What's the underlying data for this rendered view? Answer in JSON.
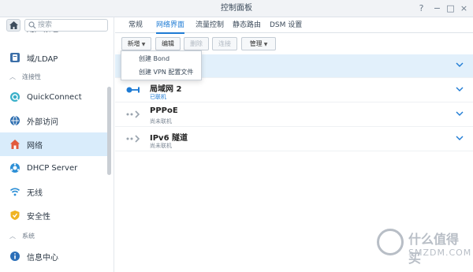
{
  "window": {
    "title": "控制面板"
  },
  "sidebar": {
    "search_placeholder": "搜索",
    "clipped_item": "用户帐组",
    "items": [
      {
        "label": "域/LDAP",
        "icon": "domain-ldap-icon"
      },
      {
        "label": "QuickConnect",
        "icon": "quickconnect-icon"
      },
      {
        "label": "外部访问",
        "icon": "external-access-icon"
      },
      {
        "label": "网络",
        "icon": "network-home-icon",
        "active": true
      },
      {
        "label": "DHCP Server",
        "icon": "dhcp-server-icon"
      },
      {
        "label": "无线",
        "icon": "wireless-icon"
      },
      {
        "label": "安全性",
        "icon": "security-shield-icon"
      },
      {
        "label": "信息中心",
        "icon": "info-center-icon"
      }
    ],
    "sections": [
      {
        "label": "连接性"
      },
      {
        "label": "系统"
      }
    ]
  },
  "tabs": [
    {
      "label": "常规"
    },
    {
      "label": "网络界面",
      "active": true
    },
    {
      "label": "流量控制"
    },
    {
      "label": "静态路由"
    },
    {
      "label": "DSM 设置"
    }
  ],
  "toolbar": {
    "create_label": "新增",
    "edit_label": "编辑",
    "delete_label": "删除",
    "connect_label": "连接",
    "manage_label": "管理"
  },
  "create_menu": {
    "items": [
      {
        "label": "创建 Bond"
      },
      {
        "label": "创建 VPN 配置文件"
      }
    ]
  },
  "interfaces": [
    {
      "name": "",
      "status": "",
      "connected": true
    },
    {
      "name": "局域网 2",
      "status": "已联机",
      "connected": true
    },
    {
      "name": "PPPoE",
      "status": "尚未联机",
      "connected": false
    },
    {
      "name": "IPv6 隧道",
      "status": "尚未联机",
      "connected": false
    }
  ],
  "watermark": {
    "line1": "什么值得买",
    "line2": "SMZDM.COM"
  },
  "colors": {
    "accent": "#1e7bd4",
    "selected_bg": "#d9ecfb",
    "sidebar_active": "#d9ecfb"
  }
}
